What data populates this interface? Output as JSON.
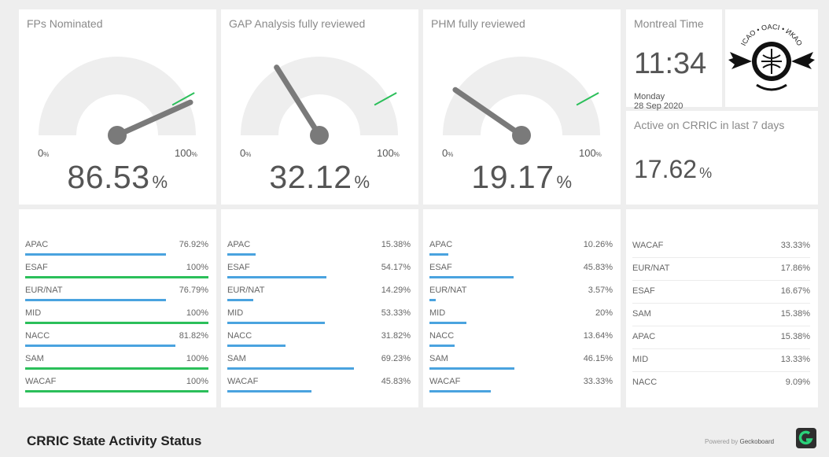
{
  "gauges": [
    {
      "title": "FPs Nominated",
      "value": "86.53",
      "fraction": 0.8653,
      "min": "0",
      "max": "100",
      "unit": "%"
    },
    {
      "title": "GAP Analysis fully reviewed",
      "value": "32.12",
      "fraction": 0.3212,
      "min": "0",
      "max": "100",
      "unit": "%"
    },
    {
      "title": "PHM fully reviewed",
      "value": "19.17",
      "fraction": 0.1917,
      "min": "0",
      "max": "100",
      "unit": "%"
    }
  ],
  "clock": {
    "title": "Montreal Time",
    "time": "11:34",
    "day": "Monday",
    "date": "28 Sep 2020"
  },
  "logo": {
    "text": "ICAO • OACI • ИКАО"
  },
  "active": {
    "title": "Active on CRRIC in last 7 days",
    "value": "17.62",
    "unit": "%"
  },
  "bar_lists": [
    {
      "rows": [
        {
          "label": "APAC",
          "value": "76.92%",
          "fraction": 0.7692
        },
        {
          "label": "ESAF",
          "value": "100%",
          "fraction": 1.0
        },
        {
          "label": "EUR/NAT",
          "value": "76.79%",
          "fraction": 0.7679
        },
        {
          "label": "MID",
          "value": "100%",
          "fraction": 1.0
        },
        {
          "label": "NACC",
          "value": "81.82%",
          "fraction": 0.8182
        },
        {
          "label": "SAM",
          "value": "100%",
          "fraction": 1.0
        },
        {
          "label": "WACAF",
          "value": "100%",
          "fraction": 1.0
        }
      ]
    },
    {
      "rows": [
        {
          "label": "APAC",
          "value": "15.38%",
          "fraction": 0.1538
        },
        {
          "label": "ESAF",
          "value": "54.17%",
          "fraction": 0.5417
        },
        {
          "label": "EUR/NAT",
          "value": "14.29%",
          "fraction": 0.1429
        },
        {
          "label": "MID",
          "value": "53.33%",
          "fraction": 0.5333
        },
        {
          "label": "NACC",
          "value": "31.82%",
          "fraction": 0.3182
        },
        {
          "label": "SAM",
          "value": "69.23%",
          "fraction": 0.6923
        },
        {
          "label": "WACAF",
          "value": "45.83%",
          "fraction": 0.4583
        }
      ]
    },
    {
      "rows": [
        {
          "label": "APAC",
          "value": "10.26%",
          "fraction": 0.1026
        },
        {
          "label": "ESAF",
          "value": "45.83%",
          "fraction": 0.4583
        },
        {
          "label": "EUR/NAT",
          "value": "3.57%",
          "fraction": 0.0357
        },
        {
          "label": "MID",
          "value": "20%",
          "fraction": 0.2
        },
        {
          "label": "NACC",
          "value": "13.64%",
          "fraction": 0.1364
        },
        {
          "label": "SAM",
          "value": "46.15%",
          "fraction": 0.4615
        },
        {
          "label": "WACAF",
          "value": "33.33%",
          "fraction": 0.3333
        }
      ]
    }
  ],
  "leaderboard": [
    {
      "label": "WACAF",
      "value": "33.33%"
    },
    {
      "label": "EUR/NAT",
      "value": "17.86%"
    },
    {
      "label": "ESAF",
      "value": "16.67%"
    },
    {
      "label": "SAM",
      "value": "15.38%"
    },
    {
      "label": "APAC",
      "value": "15.38%"
    },
    {
      "label": "MID",
      "value": "13.33%"
    },
    {
      "label": "NACC",
      "value": "9.09%"
    }
  ],
  "footer": {
    "title": "CRRIC State Activity Status",
    "powered_prefix": "Powered by",
    "powered_brand": "Geckoboard"
  },
  "colors": {
    "bar_blue": "#4aa3df",
    "bar_green": "#2bbf5a",
    "gauge_track": "#eeeeee",
    "needle": "#7a7a7a",
    "target_line": "#2bbf5a"
  }
}
